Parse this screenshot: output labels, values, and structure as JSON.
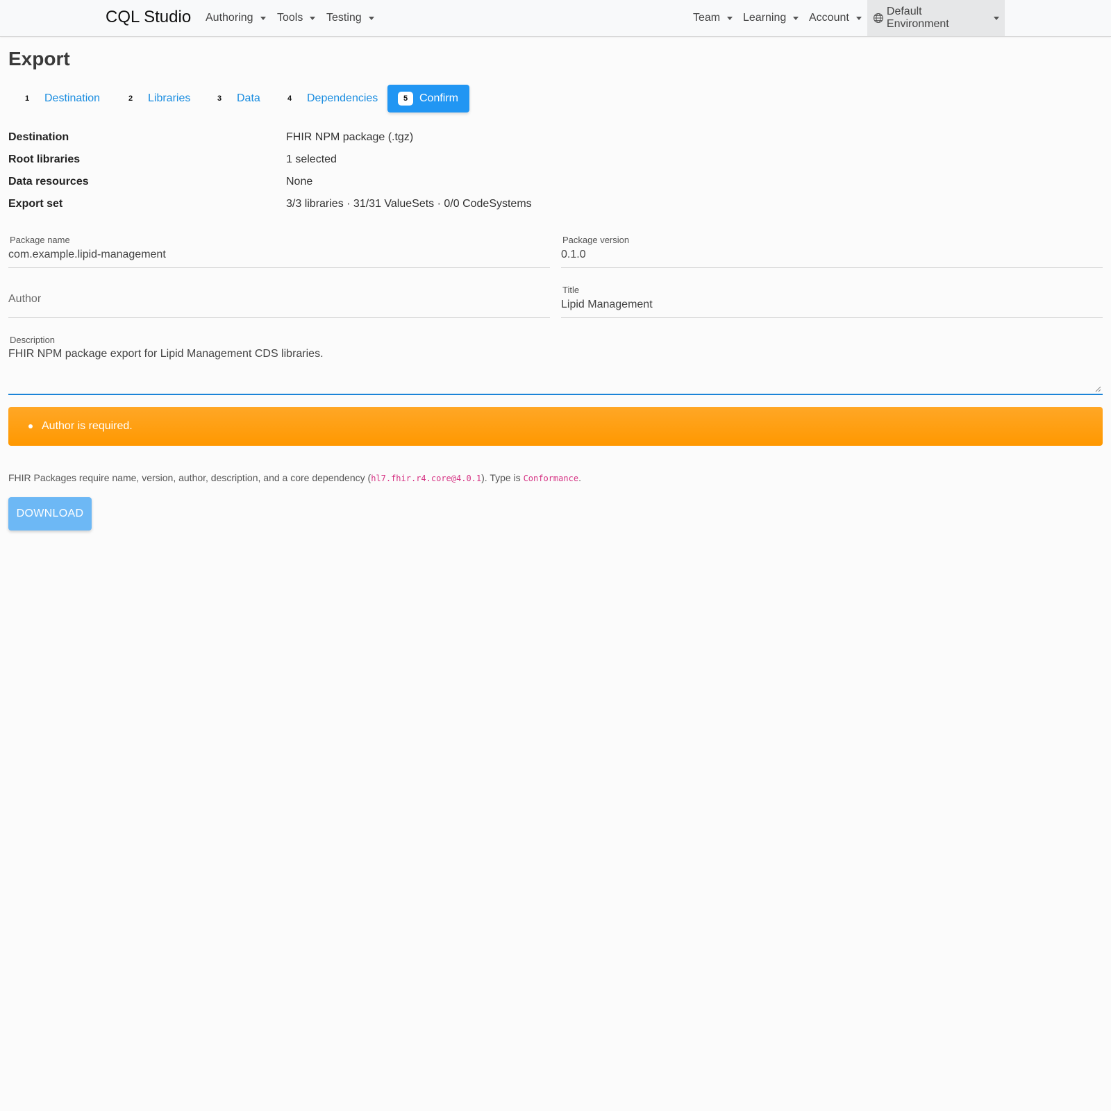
{
  "navbar": {
    "brand": "CQL Studio",
    "left_menus": [
      {
        "label": "Authoring"
      },
      {
        "label": "Tools"
      },
      {
        "label": "Testing"
      }
    ],
    "right_menus": [
      {
        "label": "Team"
      },
      {
        "label": "Learning"
      },
      {
        "label": "Account"
      }
    ],
    "environment": {
      "label": "Default Environment",
      "icon": "globe-icon"
    }
  },
  "page": {
    "title": "Export"
  },
  "stepper": {
    "active_index": 5,
    "steps": [
      {
        "number": "1",
        "label": "Destination"
      },
      {
        "number": "2",
        "label": "Libraries"
      },
      {
        "number": "3",
        "label": "Data"
      },
      {
        "number": "4",
        "label": "Dependencies"
      },
      {
        "number": "5",
        "label": "Confirm"
      }
    ]
  },
  "summary": [
    {
      "label": "Destination",
      "value": "FHIR NPM package (.tgz)"
    },
    {
      "label": "Root libraries",
      "value": "1 selected"
    },
    {
      "label": "Data resources",
      "value": "None"
    },
    {
      "label": "Export set",
      "value": "3/3 libraries · 31/31 ValueSets · 0/0 CodeSystems"
    }
  ],
  "form": {
    "package_name": {
      "label": "Package name",
      "value": "com.example.lipid-management"
    },
    "package_version": {
      "label": "Package version",
      "value": "0.1.0"
    },
    "author": {
      "placeholder": "Author",
      "value": ""
    },
    "title": {
      "label": "Title",
      "value": "Lipid Management"
    },
    "description": {
      "label": "Description",
      "value": "FHIR NPM package export for Lipid Management CDS libraries."
    }
  },
  "alert": {
    "message": "Author is required.",
    "color": "#ff9800"
  },
  "info": {
    "prefix": "FHIR Packages require name, version, author, description, and a core dependency (",
    "dependency_code": "hl7.fhir.r4.core@4.0.1",
    "middle": "). Type is ",
    "type_code": "Conformance",
    "suffix": "."
  },
  "actions": {
    "download_label": "DOWNLOAD"
  },
  "colors": {
    "accent": "#2196f3",
    "link": "#1a8de0",
    "warning": "#ff9800",
    "code": "#d63384"
  }
}
